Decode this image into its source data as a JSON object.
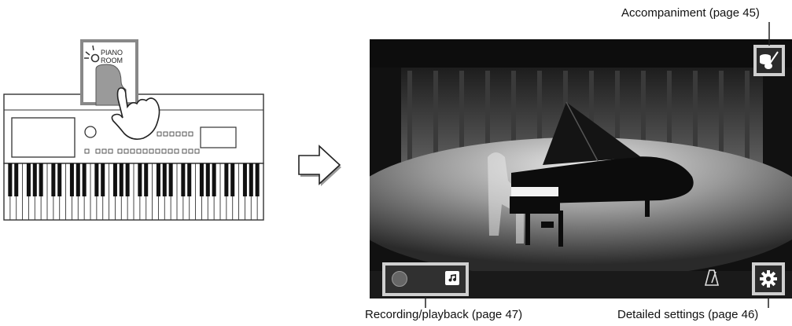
{
  "callouts": {
    "accompaniment": "Accompaniment (page 45)",
    "recording": "Recording/playback (page 47)",
    "settings": "Detailed settings (page 46)"
  },
  "keyboard": {
    "button_label_line1": "PIANO",
    "button_label_line2": "ROOM"
  },
  "icons": {
    "accompaniment": "drum-guitar-icon",
    "record": "record-circle-icon",
    "song": "music-note-icon",
    "metronome": "metronome-icon",
    "settings": "gear-icon",
    "arrow": "right-arrow-icon"
  },
  "colors": {
    "frame": "#cfcfcf",
    "screen_dark": "#111111",
    "stage_light": "#d9d9d9"
  }
}
